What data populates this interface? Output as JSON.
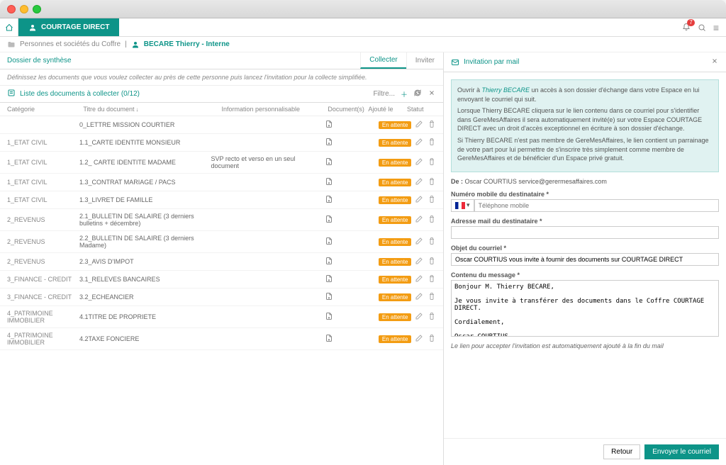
{
  "app": {
    "title": "COURTAGE DIRECT",
    "notif_count": "7"
  },
  "breadcrumb": {
    "folder": "Personnes et sociétés du Coffre",
    "user": "BECARE Thierry - Interne"
  },
  "left": {
    "dossier": "Dossier de synthèse",
    "tab_collect": "Collecter",
    "tab_invite": "Inviter",
    "instruction": "Définissez les documents que vous voulez collecter au près de cette personne puis lancez l'invitation pour la collecte simplifiée.",
    "list_title": "Liste des documents à collecter  (0/12)",
    "filter": "Filtre...",
    "headers": {
      "cat": "Catégorie",
      "title": "Titre du document",
      "info": "Information personnalisable",
      "docs": "Document(s)",
      "added": "Ajouté le",
      "status": "Statut"
    },
    "status_label": "En attente",
    "rows": [
      {
        "cat": "",
        "title": "0_LETTRE MISSION COURTIER",
        "info": ""
      },
      {
        "cat": "1_ETAT CIVIL",
        "title": "1.1_CARTE IDENTITE MONSIEUR",
        "info": ""
      },
      {
        "cat": "1_ETAT CIVIL",
        "title": "1.2_ CARTE IDENTITE MADAME",
        "info": "SVP recto et verso en un seul document"
      },
      {
        "cat": "1_ETAT CIVIL",
        "title": "1.3_CONTRAT MARIAGE / PACS",
        "info": ""
      },
      {
        "cat": "1_ETAT CIVIL",
        "title": "1.3_LIVRET DE FAMILLE",
        "info": ""
      },
      {
        "cat": "2_REVENUS",
        "title": "2.1_BULLETIN DE SALAIRE (3 derniers bulletins + décembre)",
        "info": ""
      },
      {
        "cat": "2_REVENUS",
        "title": "2.2_BULLETIN DE SALAIRE (3 derniers Madame)",
        "info": ""
      },
      {
        "cat": "2_REVENUS",
        "title": "2.3_AVIS D'IMPOT",
        "info": ""
      },
      {
        "cat": "3_FINANCE - CREDIT",
        "title": "3.1_RELEVES BANCAIRES",
        "info": ""
      },
      {
        "cat": "3_FINANCE - CREDIT",
        "title": "3.2_ECHEANCIER",
        "info": ""
      },
      {
        "cat": "4_PATRIMOINE IMMOBILIER",
        "title": "4.1TITRE DE PROPRIETE",
        "info": ""
      },
      {
        "cat": "4_PATRIMOINE IMMOBILIER",
        "title": "4.2TAXE FONCIERE",
        "info": ""
      }
    ]
  },
  "right": {
    "header": "Invitation par mail",
    "info_p1_a": "Ouvrir à ",
    "info_p1_b": "Thierry BECARE",
    "info_p1_c": " un accès à son dossier d'échange dans votre Espace en lui envoyant le courriel qui suit.",
    "info_p2": "Lorsque Thierry BECARE cliquera sur le lien contenu dans ce courriel pour s'identifier dans GereMesAffaires il sera automatiquement invité(e) sur votre Espace COURTAGE DIRECT avec un droit d'accès exceptionnel en écriture à son dossier d'échange.",
    "info_p3": "Si Thierry BECARE n'est pas membre de GereMesAffaires, le lien contient un parrainage de votre part pour lui permettre de s'inscrire très simplement comme membre de GereMesAffaires et de bénéficier d'un Espace privé gratuit.",
    "from_label": "De :",
    "from_value": "Oscar COURTIUS service@gerermesaffaires.com",
    "mobile_label": "Numéro mobile du destinataire *",
    "mobile_placeholder": "Téléphone mobile",
    "email_label": "Adresse mail du destinataire *",
    "subject_label": "Objet du courriel *",
    "subject_value": "Oscar COURTIUS vous invite à fournir des documents sur COURTAGE DIRECT",
    "body_label": "Contenu du message *",
    "body_value": "Bonjour M. Thierry BECARE,\n\nJe vous invite à transférer des documents dans le Coffre COURTAGE DIRECT.\n\nCordialement,\n\nOscar COURTIUS",
    "note": "Le lien pour accepter l'invitation est automatiquement ajouté à la fin du mail",
    "btn_back": "Retour",
    "btn_send": "Envoyer le courriel"
  }
}
